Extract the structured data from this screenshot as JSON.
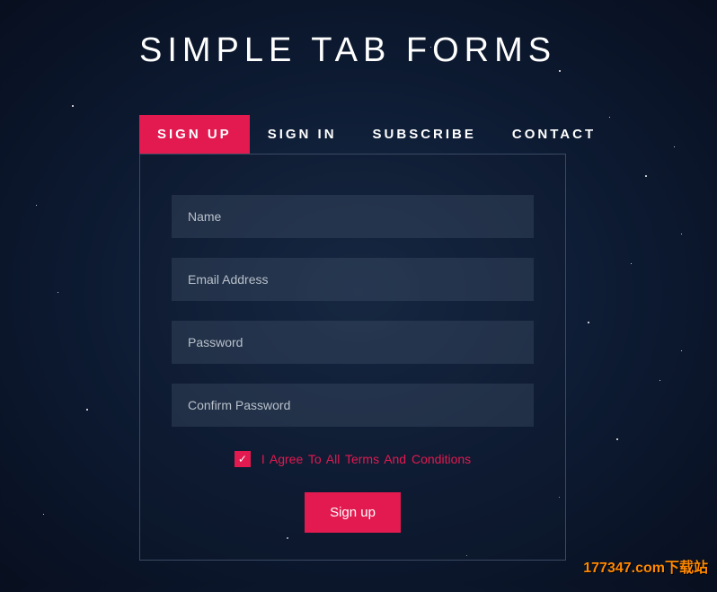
{
  "title": "SIMPLE TAB FORMS",
  "tabs": {
    "signup": "SIGN UP",
    "signin": "SIGN IN",
    "subscribe": "SUBSCRIBE",
    "contact": "CONTACT"
  },
  "form": {
    "name_placeholder": "Name",
    "email_placeholder": "Email Address",
    "password_placeholder": "Password",
    "confirm_placeholder": "Confirm Password",
    "terms_label": "I Agree To All Terms And Conditions",
    "submit_label": "Sign up"
  },
  "watermark": "177347.com下载站",
  "colors": {
    "accent": "#e21a50",
    "background_dark": "#0d1b33"
  }
}
